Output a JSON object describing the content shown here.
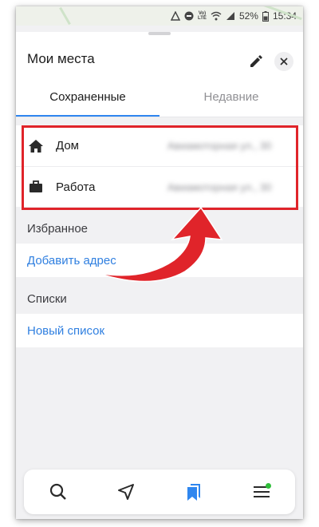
{
  "status_bar": {
    "battery": "52%",
    "time": "15:34",
    "network_label": "VoLTE"
  },
  "header": {
    "title": "Мои места"
  },
  "tabs": [
    {
      "label": "Сохраненные",
      "active": true
    },
    {
      "label": "Недавние",
      "active": false
    }
  ],
  "saved": [
    {
      "label": "Дом",
      "icon": "home-icon",
      "address": "Авиамоторная ул., 30"
    },
    {
      "label": "Работа",
      "icon": "briefcase-icon",
      "address": "Авиамоторная ул., 30"
    }
  ],
  "favorites": {
    "heading": "Избранное",
    "add_label": "Добавить адрес"
  },
  "lists": {
    "heading": "Списки",
    "new_label": "Новый список"
  },
  "bottom_nav": [
    "search-icon",
    "navigation-arrow-icon",
    "bookmarks-icon",
    "menu-icon"
  ],
  "colors": {
    "accent": "#2f86ef",
    "link": "#2f7fe0",
    "highlight": "#e0242a",
    "notification_dot": "#2fbf3a"
  }
}
